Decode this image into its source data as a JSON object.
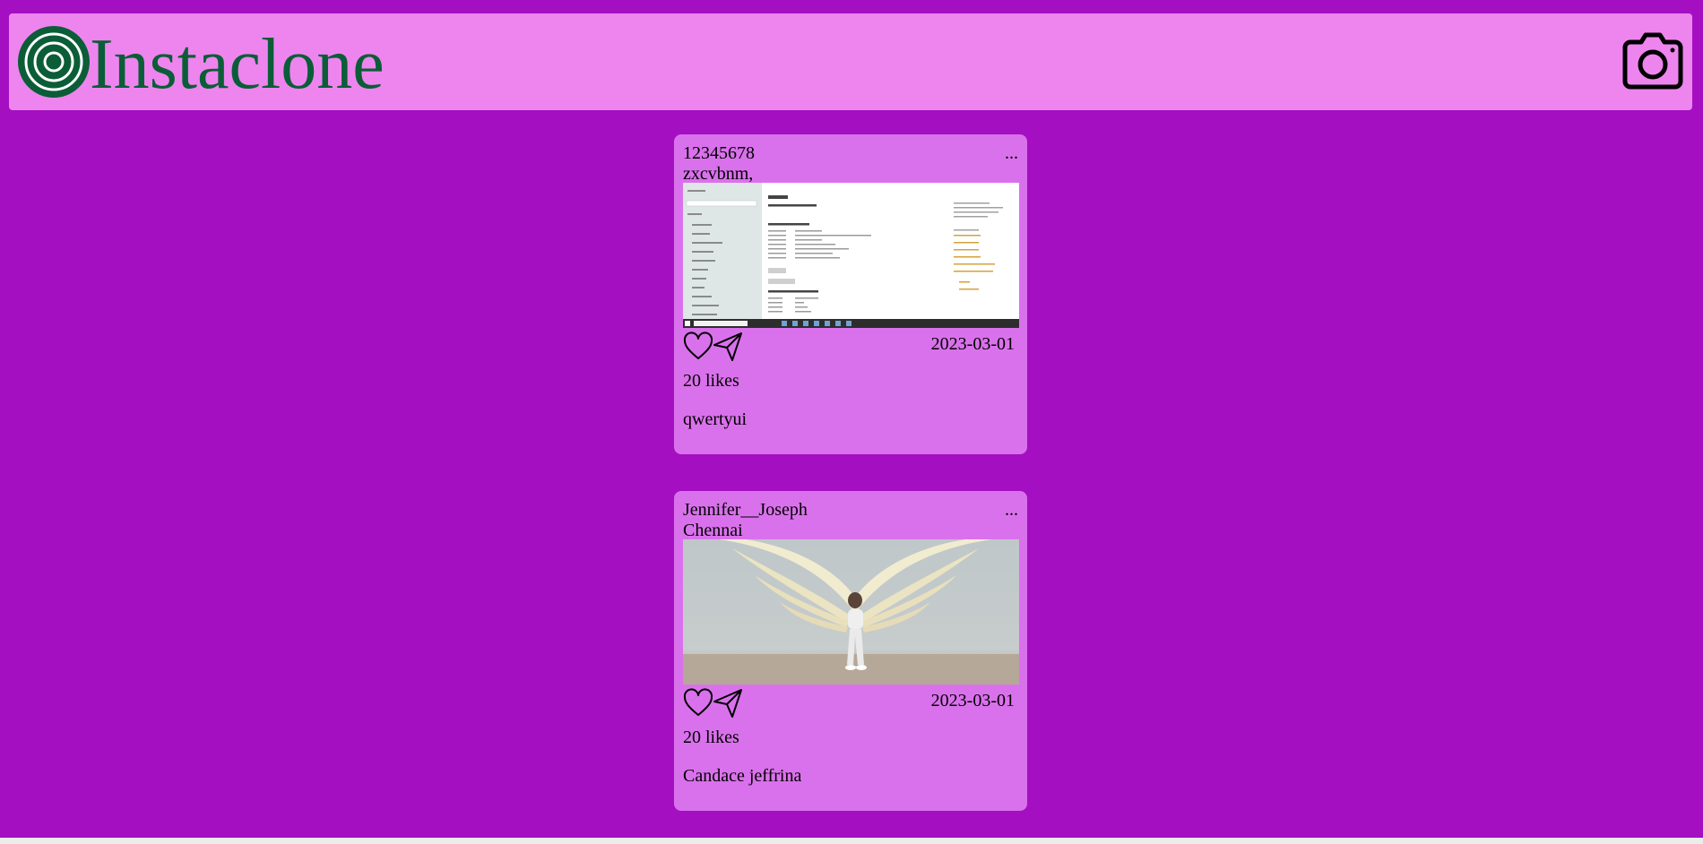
{
  "app": {
    "title": "Instaclone",
    "logo_icon": "target-rings-icon",
    "upload_icon": "camera-icon",
    "colors": {
      "background": "#a30fc1",
      "header": "#ee85ee",
      "card": "#da71ec",
      "brand_text": "#0b5d37"
    }
  },
  "posts": [
    {
      "username": "12345678",
      "location": "zxcvbnm,",
      "more": "...",
      "image_alt": "screenshot-windows-about-settings",
      "date": "2023-03-01",
      "likes": "20 likes",
      "caption": "qwertyui"
    },
    {
      "username": "Jennifer__Joseph",
      "location": "Chennai",
      "more": "...",
      "image_alt": "person-standing-in-front-of-angel-wings-mural",
      "date": "2023-03-01",
      "likes": "20 likes",
      "caption": "Candace jeffrina"
    }
  ]
}
